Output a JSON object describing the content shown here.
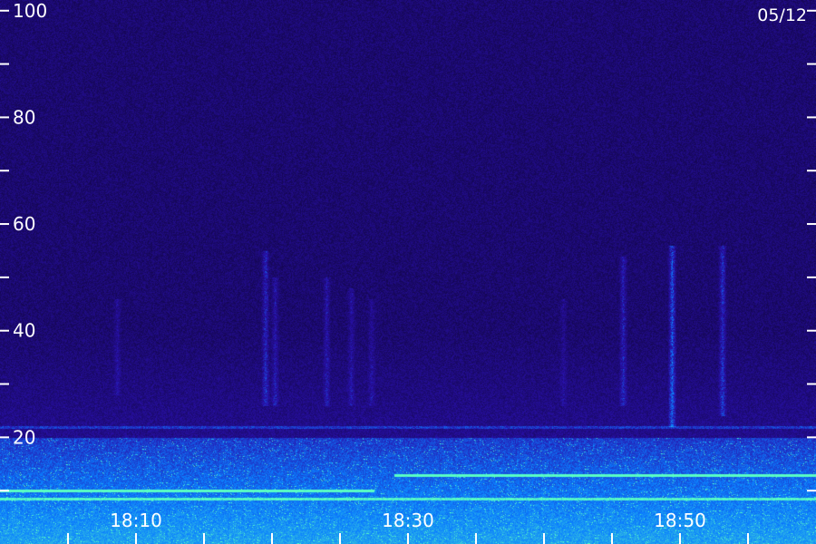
{
  "date_label": "05/12",
  "colors": {
    "background": "#1a0866",
    "signal": "#2860ff",
    "strong_signal": "#00ffc8",
    "tick": "#ffffff"
  },
  "chart_data": {
    "type": "heatmap",
    "title": "",
    "xlabel": "",
    "ylabel": "",
    "x_axis": {
      "type": "time",
      "range": [
        "18:00",
        "19:00"
      ],
      "tick_labels": [
        "18:10",
        "18:30",
        "18:50"
      ],
      "label_positions_min": [
        10,
        30,
        50
      ],
      "minor_tick_interval_min": 5
    },
    "y_axis": {
      "range": [
        0,
        102
      ],
      "tick_labels": [
        "20",
        "40",
        "60",
        "80",
        "100"
      ],
      "tick_values": [
        20,
        40,
        60,
        80,
        100
      ],
      "minor_tick_values": [
        10,
        30,
        50,
        70,
        90
      ]
    },
    "grid": false,
    "legend": "none",
    "features": [
      {
        "kind": "vertical-streak",
        "time_min": 8.6,
        "y_range": [
          28,
          46
        ],
        "intensity": 0.25
      },
      {
        "kind": "vertical-streak",
        "time_min": 19.5,
        "y_range": [
          26,
          55
        ],
        "intensity": 0.5
      },
      {
        "kind": "vertical-streak",
        "time_min": 20.2,
        "y_range": [
          26,
          50
        ],
        "intensity": 0.35
      },
      {
        "kind": "vertical-streak",
        "time_min": 24.0,
        "y_range": [
          26,
          50
        ],
        "intensity": 0.35
      },
      {
        "kind": "vertical-streak",
        "time_min": 25.8,
        "y_range": [
          26,
          48
        ],
        "intensity": 0.3
      },
      {
        "kind": "vertical-streak",
        "time_min": 27.3,
        "y_range": [
          26,
          46
        ],
        "intensity": 0.25
      },
      {
        "kind": "vertical-streak",
        "time_min": 41.4,
        "y_range": [
          26,
          46
        ],
        "intensity": 0.2
      },
      {
        "kind": "vertical-streak",
        "time_min": 45.8,
        "y_range": [
          26,
          54
        ],
        "intensity": 0.45
      },
      {
        "kind": "vertical-streak",
        "time_min": 49.4,
        "y_range": [
          22,
          56
        ],
        "intensity": 0.75
      },
      {
        "kind": "vertical-streak",
        "time_min": 53.1,
        "y_range": [
          24,
          56
        ],
        "intensity": 0.55
      },
      {
        "kind": "horizontal-line",
        "y_value": 22,
        "time_range": [
          0,
          60
        ],
        "intensity": 0.3
      },
      {
        "kind": "horizontal-line",
        "y_value": 13,
        "time_range": [
          29.0,
          60
        ],
        "intensity": 0.95
      },
      {
        "kind": "horizontal-line",
        "y_value": 10,
        "time_range": [
          0,
          27.5
        ],
        "intensity": 0.9
      },
      {
        "kind": "horizontal-line",
        "y_value": 8.5,
        "time_range": [
          0,
          60
        ],
        "intensity": 0.6
      }
    ]
  }
}
